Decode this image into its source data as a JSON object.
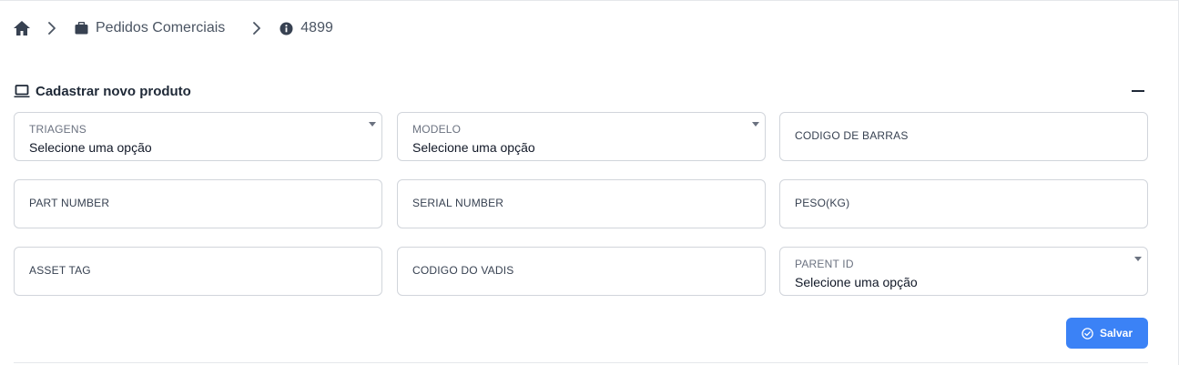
{
  "breadcrumb": {
    "home_icon": "home-icon",
    "items": [
      {
        "icon": "briefcase-icon",
        "label": "Pedidos Comerciais"
      },
      {
        "icon": "info-circle-icon",
        "label": "4899"
      }
    ]
  },
  "section": {
    "icon": "laptop-icon",
    "title": "Cadastrar novo produto",
    "collapse_icon": "minus-icon"
  },
  "form": {
    "triagens": {
      "label": "TRIAGENS",
      "value": "Selecione uma opção"
    },
    "modelo": {
      "label": "MODELO",
      "value": "Selecione uma opção"
    },
    "codigo_barras": {
      "placeholder": "CODIGO DE BARRAS"
    },
    "part_number": {
      "placeholder": "PART NUMBER"
    },
    "serial_number": {
      "placeholder": "SERIAL NUMBER"
    },
    "peso": {
      "placeholder": "PESO(KG)"
    },
    "asset_tag": {
      "placeholder": "ASSET TAG"
    },
    "codigo_vadis": {
      "placeholder": "CODIGO DO VADIS"
    },
    "parent_id": {
      "label": "PARENT ID",
      "value": "Selecione uma opção"
    }
  },
  "actions": {
    "save_label": "Salvar",
    "save_icon": "check-circle-icon"
  },
  "colors": {
    "primary": "#3b82f6",
    "text": "#374151",
    "border": "#d1d5db"
  }
}
